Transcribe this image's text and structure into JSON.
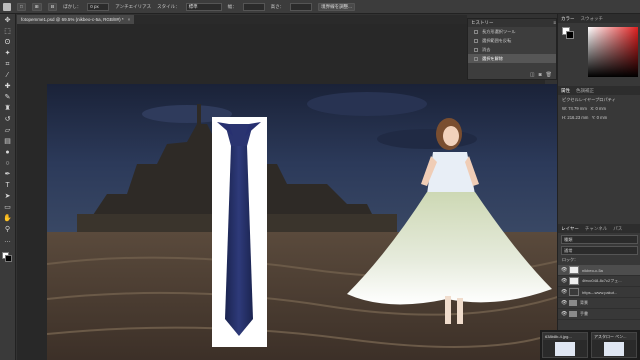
{
  "options_bar": {
    "feather_label": "ぼかし：",
    "feather_value": "0 px",
    "antialias_label": "アンチエイリアス",
    "style_label": "スタイル：",
    "style_value": "標準",
    "width_label": "幅：",
    "height_label": "高さ：",
    "refine_button": "境界線を調整..."
  },
  "document_tab": {
    "title": "fotopemme1.psd @ 69.5% (nikbeo-c-5a, RGB/8#) *",
    "close": "×"
  },
  "history_panel": {
    "title": "ヒストリー",
    "items": [
      {
        "label": "長方形選択ツール"
      },
      {
        "label": "選択範囲を反転"
      },
      {
        "label": "消去"
      },
      {
        "label": "選択を解除",
        "selected": true
      }
    ]
  },
  "color_panel": {
    "tabs": [
      "カラー",
      "スウォッチ"
    ]
  },
  "properties_panel": {
    "tabs": [
      "属性",
      "色調補正"
    ],
    "title": "ピクセルレイヤープロパティ",
    "w_label": "W:",
    "w_value": "74.79 mm",
    "x_label": "X:",
    "x_value": "0 mm",
    "h_label": "H:",
    "h_value": "216.23 mm",
    "y_label": "Y:",
    "y_value": "0 mm"
  },
  "layers_panel": {
    "tabs": [
      "レイヤー",
      "チャンネル",
      "パス"
    ],
    "kind_value": "種類",
    "blend_value": "通常",
    "lock_label": "ロック：",
    "layers": [
      {
        "name": "nikbeo-c-5a",
        "selected": true,
        "thumb": "light"
      },
      {
        "name": "4fecc048-8c7c2フェ...",
        "thumb": "light"
      },
      {
        "name": "https---www.pakut...",
        "thumb": "dark"
      },
      {
        "name": "背景",
        "folder": true
      },
      {
        "name": "手書",
        "folder": true
      }
    ]
  },
  "taskbar": {
    "thumbs": [
      {
        "title": "638b8b-4.jpg..."
      },
      {
        "title": "アスタロー ペン..."
      }
    ]
  },
  "icons": {
    "move": "move-icon",
    "marquee": "marquee-icon",
    "lasso": "lasso-icon",
    "magic": "magic-wand-icon",
    "crop": "crop-icon",
    "eyedropper": "eyedropper-icon",
    "brush": "brush-icon",
    "stamp": "stamp-icon",
    "eraser": "eraser-icon",
    "gradient": "gradient-icon",
    "pen": "pen-icon",
    "type": "type-icon",
    "hand": "hand-icon",
    "zoom": "zoom-icon"
  }
}
